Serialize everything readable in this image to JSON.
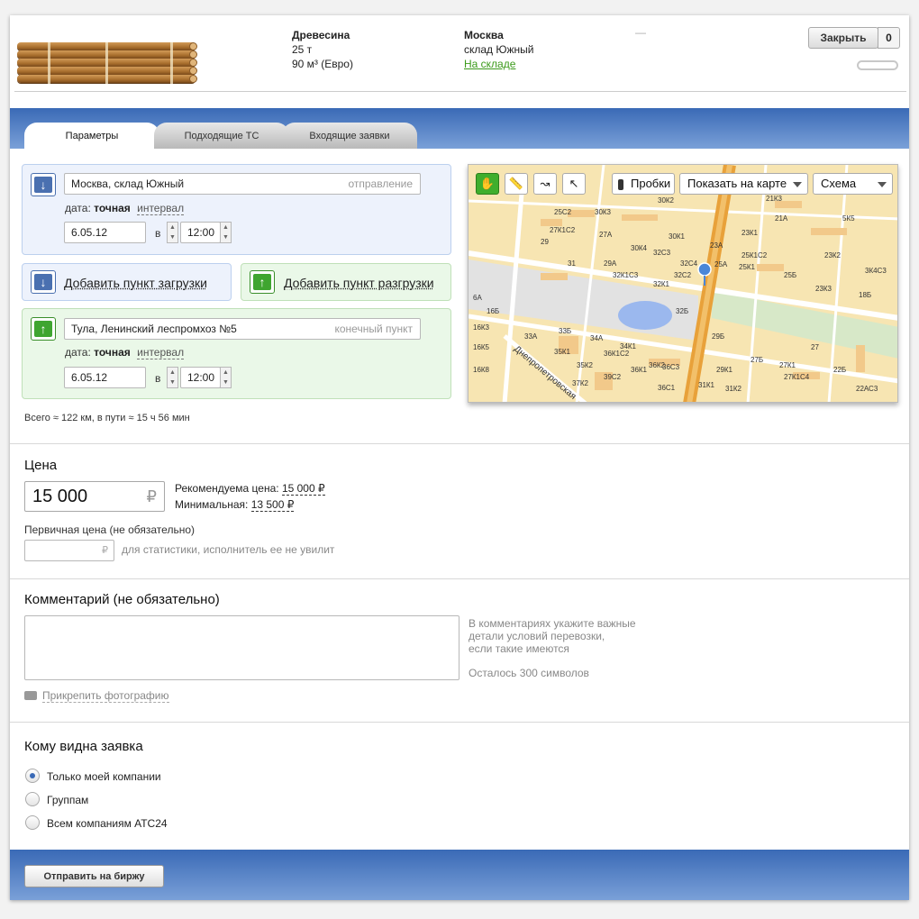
{
  "header": {
    "cargo": {
      "title": "Древесина",
      "weight": "25 т",
      "volume": "90 м³ (Евро)"
    },
    "location": {
      "city": "Москва",
      "warehouse": "склад Южный",
      "status": "На складе"
    },
    "dash": "—",
    "close_label": "Закрыть",
    "close_count": "0"
  },
  "tabs": [
    {
      "label": "Параметры",
      "active": true
    },
    {
      "label": "Подходящие ТС",
      "active": false
    },
    {
      "label": "Входящие заявки",
      "active": false
    }
  ],
  "route": {
    "origin": {
      "address": "Москва, склад Южный",
      "hint": "отправление",
      "date_label": "дата:",
      "mode_exact": "точная",
      "mode_interval": "интервал",
      "date": "6.05.12",
      "at": "в",
      "time": "12:00"
    },
    "add_loading": "Добавить пункт загрузки",
    "add_unloading": "Добавить пункт разгрузки",
    "destination": {
      "address": "Тула, Ленинский леспромхоз №5",
      "hint": "конечный пункт",
      "date_label": "дата:",
      "mode_exact": "точная",
      "mode_interval": "интервал",
      "date": "6.05.12",
      "at": "в",
      "time": "12:00"
    },
    "total": "Всего ≈ 122 км, в пути ≈ 15 ч 56 мин"
  },
  "map": {
    "traffic_label": "Пробки",
    "show_on_map": "Показать на карте",
    "layer": "Схема",
    "street": "Днепропетровская",
    "tools": [
      "hand-icon",
      "ruler-icon",
      "route-icon",
      "pointer-icon"
    ],
    "labels": [
      "25С2",
      "30К3",
      "30К2",
      "21К3",
      "5К5",
      "27К1С2",
      "27А",
      "21А",
      "29",
      "30К4",
      "30К1",
      "23К1",
      "31",
      "29А",
      "32С3",
      "32С4",
      "25К1С2",
      "23К2",
      "3К4С3",
      "32К1С3",
      "32К1",
      "32С2",
      "25А",
      "25К1",
      "25Б",
      "23К3",
      "18Б",
      "32Б",
      "16К3",
      "33А",
      "33Б",
      "34А",
      "34К1",
      "29Б",
      "27Б",
      "27",
      "35К1",
      "36К1С2",
      "36К2",
      "27К1",
      "22Б",
      "16К5",
      "16К8",
      "35К2",
      "36К1",
      "36С3",
      "29К1",
      "27К1С4",
      "37К2",
      "39С2",
      "36С1",
      "31К1",
      "31К2",
      "22АС3",
      "6А",
      "16Б",
      "23А"
    ]
  },
  "price": {
    "title": "Цена",
    "value": "15 000",
    "currency": "₽",
    "recommended_label": "Рекомендуема цена:",
    "recommended_value": "15 000 ₽",
    "min_label": "Минимальная:",
    "min_value": "13 500 ₽",
    "primary_label": "Первичная цена (не обязательно)",
    "primary_hint": "для статистики, исполнитель ее не увилит"
  },
  "comment": {
    "title": "Комментарий (не обязательно)",
    "hint_line1": "В комментариях укажите важные",
    "hint_line2": "детали условий перевозки,",
    "hint_line3": "если такие имеются",
    "remaining": "Осталось 300 символов",
    "attach": "Прикрепить фотографию"
  },
  "visibility": {
    "title": "Кому видна заявка",
    "options": [
      {
        "label": "Только моей компании",
        "selected": true
      },
      {
        "label": "Группам",
        "selected": false
      },
      {
        "label": "Всем компаниям АТС24",
        "selected": false
      }
    ]
  },
  "footer": {
    "submit": "Отправить на биржу"
  }
}
